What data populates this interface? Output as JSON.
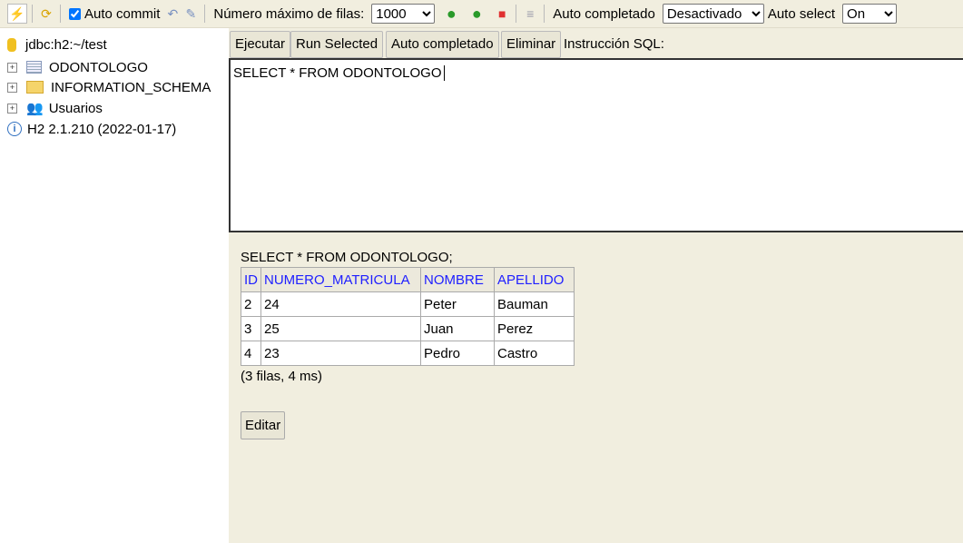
{
  "toolbar": {
    "auto_commit": "Auto commit",
    "max_rows_label": "Número máximo de filas:",
    "max_rows": "1000",
    "autocomplete_label": "Auto completado",
    "autocomplete_value": "Desactivado",
    "autoselect_label": "Auto select",
    "autoselect_value": "On"
  },
  "tree": {
    "connection": "jdbc:h2:~/test",
    "items": [
      "ODONTOLOGO",
      "INFORMATION_SCHEMA",
      "Usuarios"
    ],
    "version": "H2 2.1.210 (2022-01-17)"
  },
  "buttons": {
    "run": "Ejecutar",
    "run_selected": "Run Selected",
    "autocomplete": "Auto completado",
    "clear": "Eliminar",
    "sql_label": "Instrucción SQL:"
  },
  "sql": "SELECT * FROM ODONTOLOGO",
  "result": {
    "query": "SELECT * FROM ODONTOLOGO;",
    "columns": [
      "ID",
      "NUMERO_MATRICULA",
      "NOMBRE",
      "APELLIDO"
    ],
    "rows": [
      [
        "2",
        "24",
        "Peter",
        "Bauman"
      ],
      [
        "3",
        "25",
        "Juan",
        "Perez"
      ],
      [
        "4",
        "23",
        "Pedro",
        "Castro"
      ]
    ],
    "summary": "(3 filas, 4 ms)",
    "edit": "Editar"
  }
}
